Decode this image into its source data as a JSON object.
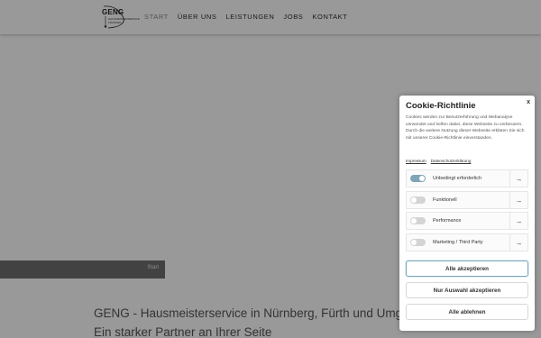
{
  "logo": {
    "title": "GENG",
    "subtitle_line1": "HAUSMEISTERSERVICE",
    "subtitle_line2": "FRANKEN"
  },
  "nav": {
    "items": [
      {
        "label": "START",
        "active": true
      },
      {
        "label": "ÜBER UNS",
        "active": false
      },
      {
        "label": "LEISTUNGEN",
        "active": false
      },
      {
        "label": "JOBS",
        "active": false
      },
      {
        "label": "KONTAKT",
        "active": false
      }
    ]
  },
  "hero": {
    "slider_label": "Start"
  },
  "content": {
    "title": "GENG - Hausmeisterservice in Nürnberg, Fürth und Umgebung",
    "subtitle": "Ein starker Partner an Ihrer Seite"
  },
  "cookie": {
    "title": "Cookie-Richtlinie",
    "close": "x",
    "text": "Cookies werden zur Benutzerführung und Webanalyse verwendet und helfen dabei, diese Webseite zu verbessern. Durch die weitere Nutzung dieser Webseite erklären Sie sich mit unserer Cookie-Richtlinie einverstanden.",
    "links": {
      "imprint": "Impressum",
      "privacy": "Datenschutzerklärung"
    },
    "options": [
      {
        "label": "Unbedingt erforderlich",
        "enabled": true
      },
      {
        "label": "Funktionell",
        "enabled": false
      },
      {
        "label": "Performance",
        "enabled": false
      },
      {
        "label": "Marketing / Third Party",
        "enabled": false
      }
    ],
    "arrow": "→",
    "buttons": {
      "accept_all": "Alle akzeptieren",
      "accept_selection": "Nur Auswahl akzeptieren",
      "reject_all": "Alle ablehnen"
    }
  },
  "colors": {
    "accent": "#7aa6b9",
    "toggle_on": "#7fa5b6",
    "slider_bar": "#6f6f6f",
    "overlay": "rgba(0,0,0,0.4)"
  }
}
